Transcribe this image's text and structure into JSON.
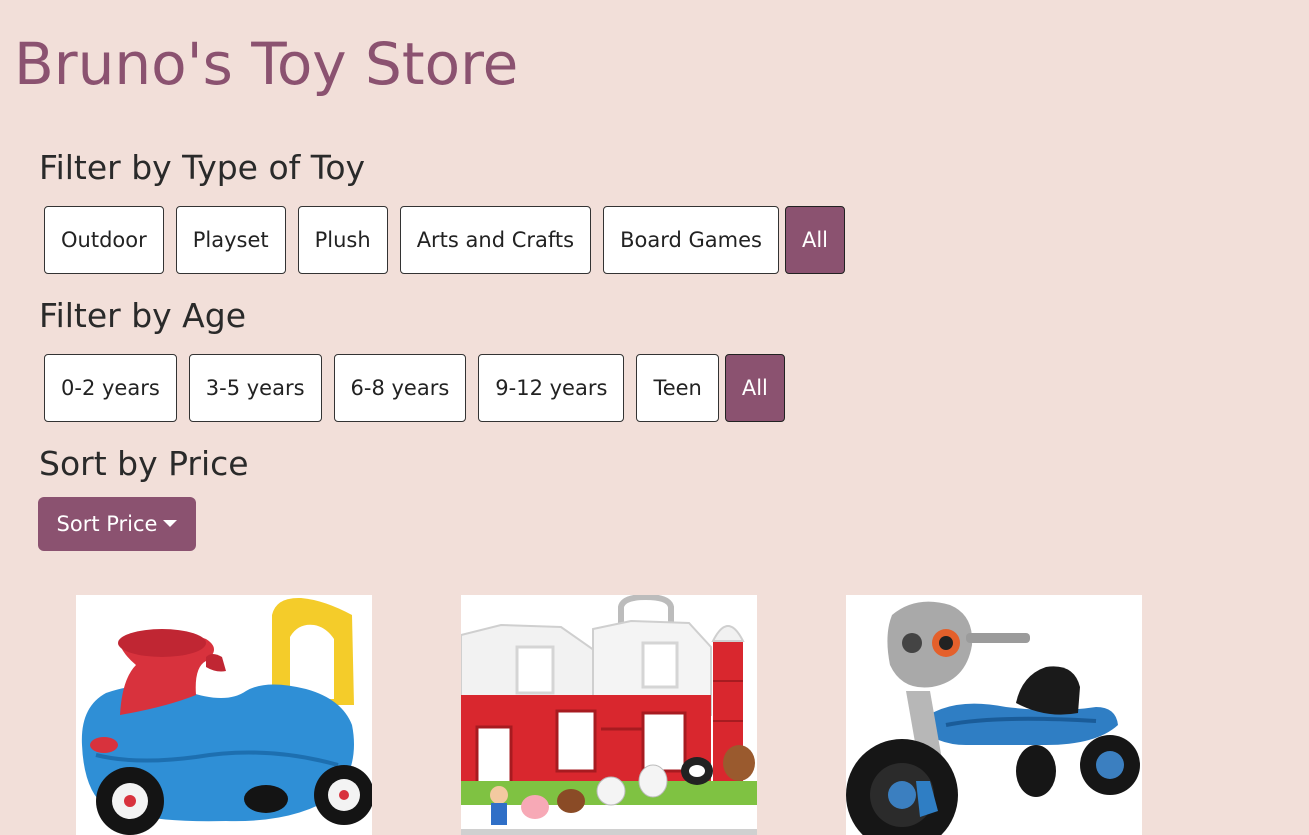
{
  "store": {
    "title": "Bruno's Toy Store"
  },
  "filters": {
    "type": {
      "heading": "Filter by Type of Toy",
      "options": [
        "Outdoor",
        "Playset",
        "Plush",
        "Arts and Crafts",
        "Board Games",
        "All"
      ],
      "selected": "All"
    },
    "age": {
      "heading": "Filter by Age",
      "options": [
        "0-2 years",
        "3-5 years",
        "6-8 years",
        "9-12 years",
        "Teen",
        "All"
      ],
      "selected": "All"
    }
  },
  "sort": {
    "heading": "Sort by Price",
    "button_label": "Sort Price"
  },
  "products": [
    {
      "image": "ride-on-car-image"
    },
    {
      "image": "farm-playset-image"
    },
    {
      "image": "tricycle-image"
    }
  ],
  "colors": {
    "accent": "#8b5270",
    "background": "#f2dfd9"
  }
}
